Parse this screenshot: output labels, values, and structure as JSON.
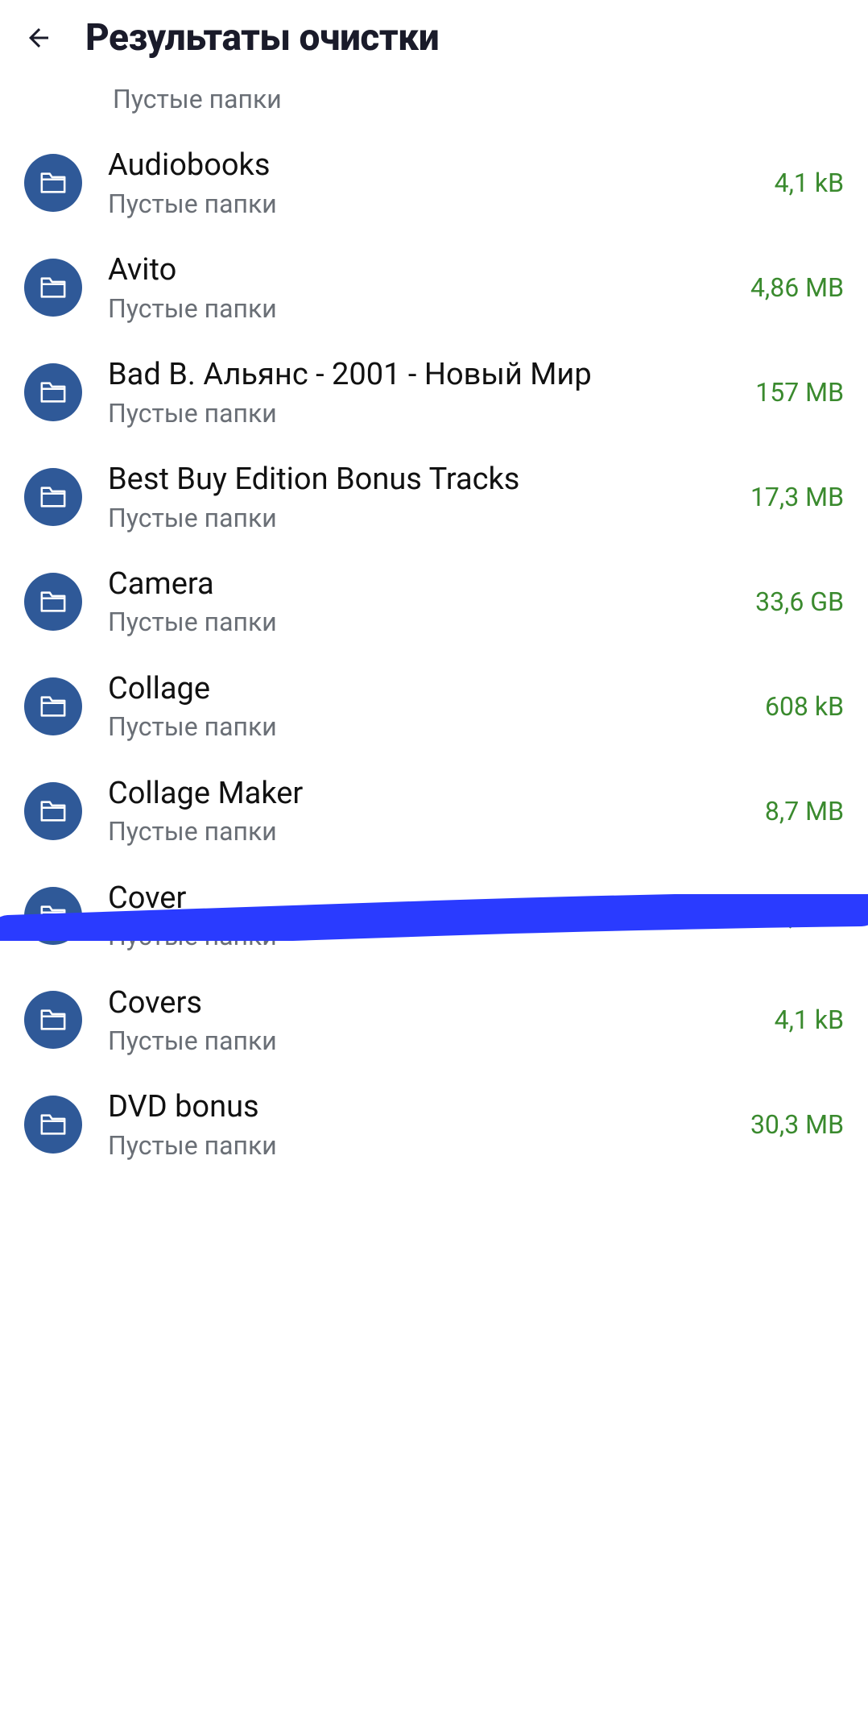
{
  "header": {
    "title": "Результаты очистки"
  },
  "subtext": "Пустые папки",
  "partial": {
    "sub": "Пустые папки"
  },
  "items": [
    {
      "title": "Audiobooks",
      "size": "4,1 kB"
    },
    {
      "title": "Avito",
      "size": "4,86 MB"
    },
    {
      "title": "Bad B. Альянс - 2001 - Новый Мир",
      "size": "157 MB"
    },
    {
      "title": "Best Buy Edition Bonus Tracks",
      "size": "17,3 MB"
    },
    {
      "title": "Camera",
      "size": "33,6 GB"
    },
    {
      "title": "Collage",
      "size": "608 kB"
    },
    {
      "title": "Collage Maker",
      "size": "8,7 MB"
    },
    {
      "title": "Cover",
      "size": "4,1 kB"
    },
    {
      "title": "Covers",
      "size": "4,1 kB"
    },
    {
      "title": "DVD bonus",
      "size": "30,3 MB"
    }
  ],
  "colors": {
    "icon_bg": "#2f5998",
    "size_color": "#3a8a2e",
    "annotation": "#2a3bff"
  }
}
